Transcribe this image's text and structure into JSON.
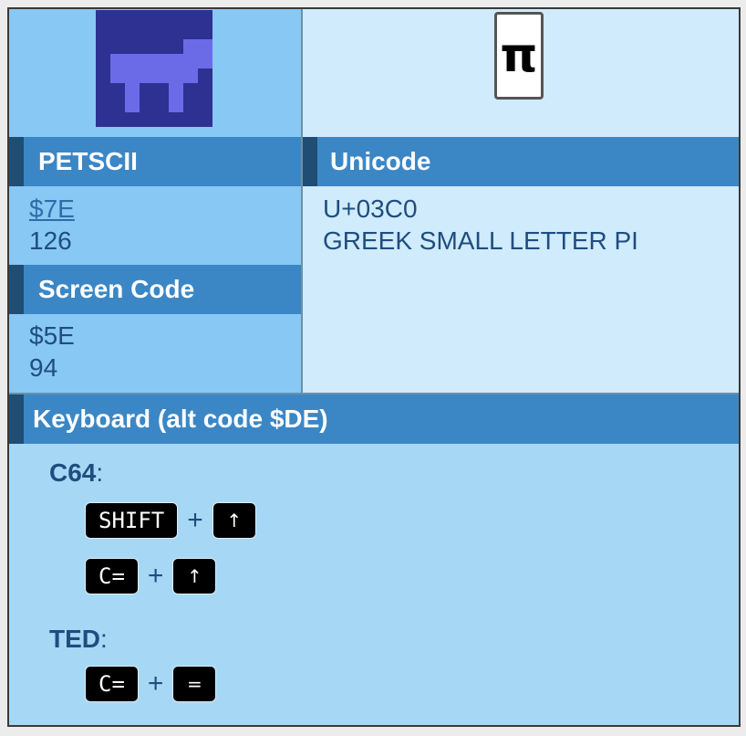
{
  "petscii": {
    "heading": "PETSCII",
    "hex": "$7E",
    "dec": "126"
  },
  "unicode": {
    "glyph": "π",
    "heading": "Unicode",
    "codepoint": "U+03C0",
    "name": "GREEK SMALL LETTER PI"
  },
  "screen_code": {
    "heading": "Screen Code",
    "hex": "$5E",
    "dec": "94"
  },
  "keyboard": {
    "heading": "Keyboard (alt code $DE)",
    "plus": "+",
    "c64": {
      "label": "C64",
      "combos": [
        [
          "SHIFT",
          "↑"
        ],
        [
          "C=",
          "↑"
        ]
      ]
    },
    "ted": {
      "label": "TED",
      "combos": [
        [
          "C=",
          "="
        ]
      ]
    }
  },
  "colors": {
    "petscii_glyph_bg": "#2e3192",
    "petscii_glyph_fg": "#6b6be8",
    "header_bg": "#3b87c6",
    "header_accent": "#1f4d73"
  }
}
